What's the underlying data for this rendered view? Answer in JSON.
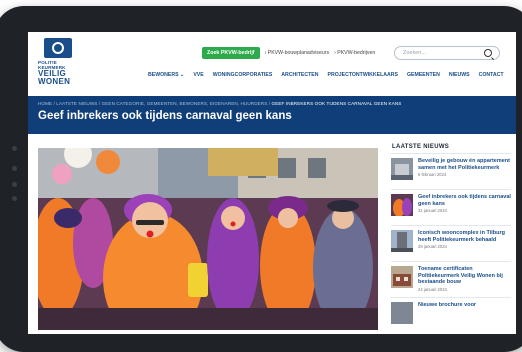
{
  "logo": {
    "line1": "POLITIE",
    "line2": "KEURMERK",
    "line3": "VEILIG",
    "line4": "WONEN"
  },
  "topnav": {
    "cta": "Zoek PKVW-bedrijf",
    "link1": "› PKVW-bouwplanadviseurs",
    "link2": "› PKVW-bedrijven"
  },
  "search": {
    "placeholder": "Zoeken..."
  },
  "mainnav": [
    "BEWONERS ⌄",
    "VVE",
    "WONINGCORPORATIES",
    "ARCHITECTEN",
    "PROJECTONTWIKKELAARS",
    "GEMEENTEN",
    "NIEUWS",
    "CONTACT"
  ],
  "breadcrumb": {
    "trail": "HOME  /  LAATSTE NIEUWS  /  GEEN CATEGORIE, GEMEENTEN, BEWONERS, EIGENAREN, HUURDERS  /",
    "current": "GEEF INBREKERS OOK TIJDENS CARNAVAL GEEN KANS"
  },
  "page_title": "Geef inbrekers ook tijdens carnaval geen kans",
  "sidebar": {
    "heading": "LAATSTE NIEUWS",
    "items": [
      {
        "title": "Beveilig je gebouw én appartement samen met het Politiekeurmerk",
        "date": "5 februari 2024"
      },
      {
        "title": "Geef inbrekers ook tijdens carnaval geen kans",
        "date": "31 januari 2024"
      },
      {
        "title": "Iconisch wooncomplex in Tilburg heeft Politiekeurmerk behaald",
        "date": "29 januari 2024"
      },
      {
        "title": "Toename certificaten Politiekeurmerk Veilig Wonen bij bestaande bouw",
        "date": "24 januari 2024"
      },
      {
        "title": "Nieuwe brochure voor",
        "date": ""
      }
    ]
  },
  "colors": {
    "brand_blue": "#0f3e78",
    "cta_green": "#2daa4b",
    "device": "#1f2328"
  }
}
